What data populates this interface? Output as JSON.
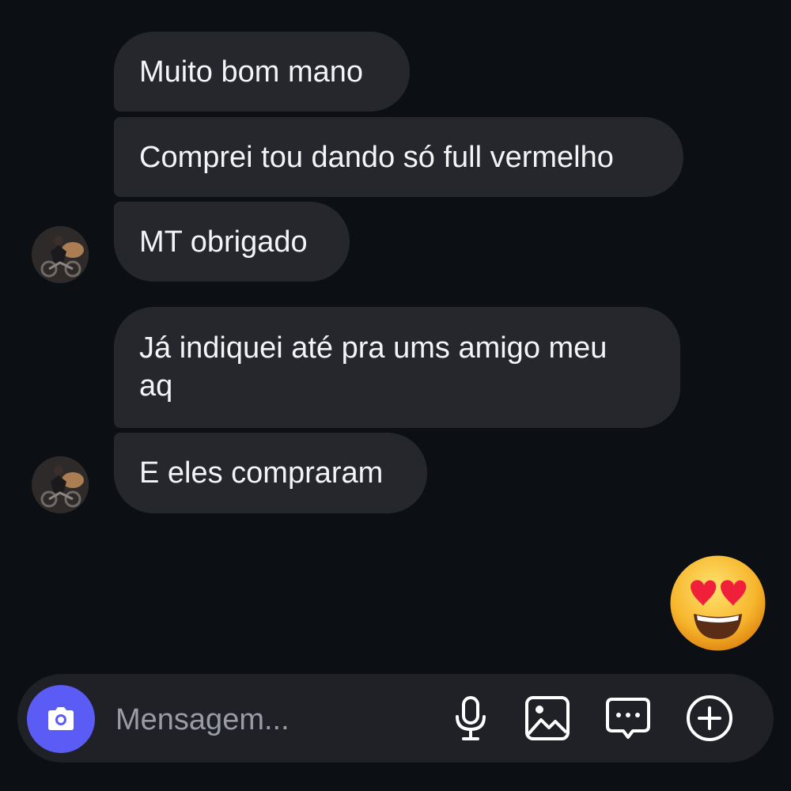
{
  "messages": [
    {
      "text": "Muito bom mano"
    },
    {
      "text": "Comprei tou dando só full vermelho"
    },
    {
      "text": "MT obrigado"
    },
    {
      "text": "Já indiquei até pra ums amigo meu aq"
    },
    {
      "text": "E eles compraram"
    }
  ],
  "reaction": {
    "emoji": "heart-eyes-emoji"
  },
  "composer": {
    "placeholder": "Mensagem...",
    "icons": [
      "camera-icon",
      "microphone-icon",
      "gallery-icon",
      "sticker-icon",
      "plus-icon"
    ],
    "camera_color": "#5b5bf5"
  },
  "colors": {
    "background": "#0c0f14",
    "bubble": "#26272d",
    "composer": "#1f2127"
  }
}
